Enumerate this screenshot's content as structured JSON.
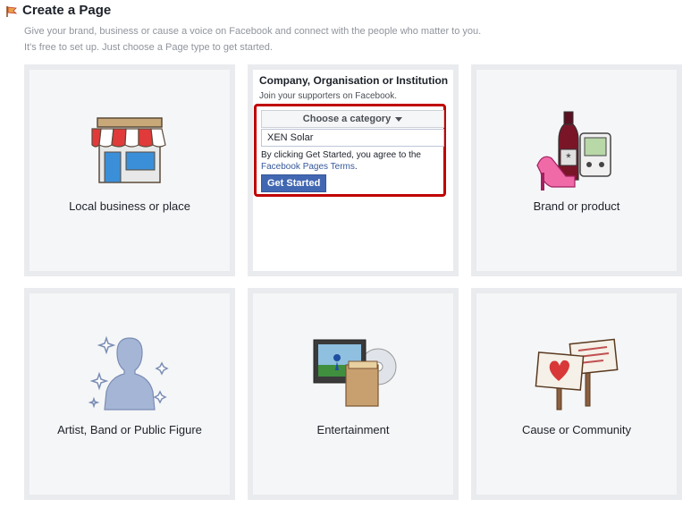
{
  "header": {
    "title": "Create a Page",
    "intro_line1": "Give your brand, business or cause a voice on Facebook and connect with the people who matter to you.",
    "intro_line2": "It's free to set up. Just choose a Page type to get started."
  },
  "tiles": {
    "local": {
      "label": "Local business or place",
      "icon": "storefront-icon"
    },
    "company": {
      "label": "Company, Organisation or Institution",
      "subtitle": "Join your supporters on Facebook.",
      "category_select": "Choose a category",
      "name_value": "XEN Solar",
      "terms_text": "By clicking Get Started, you agree to the",
      "terms_link": "Facebook Pages Terms",
      "terms_end": ".",
      "button": "Get Started"
    },
    "brand": {
      "label": "Brand or product",
      "icon": "products-icon"
    },
    "artist": {
      "label": "Artist, Band or Public Figure",
      "icon": "person-sparkles-icon"
    },
    "entertainment": {
      "label": "Entertainment",
      "icon": "tv-media-icon"
    },
    "cause": {
      "label": "Cause or Community",
      "icon": "protest-signs-icon"
    }
  },
  "colors": {
    "highlight": "#c00000",
    "button": "#4267b2",
    "link": "#365899",
    "tile_bg": "#f5f6f7",
    "tile_border": "#e9ebee"
  }
}
